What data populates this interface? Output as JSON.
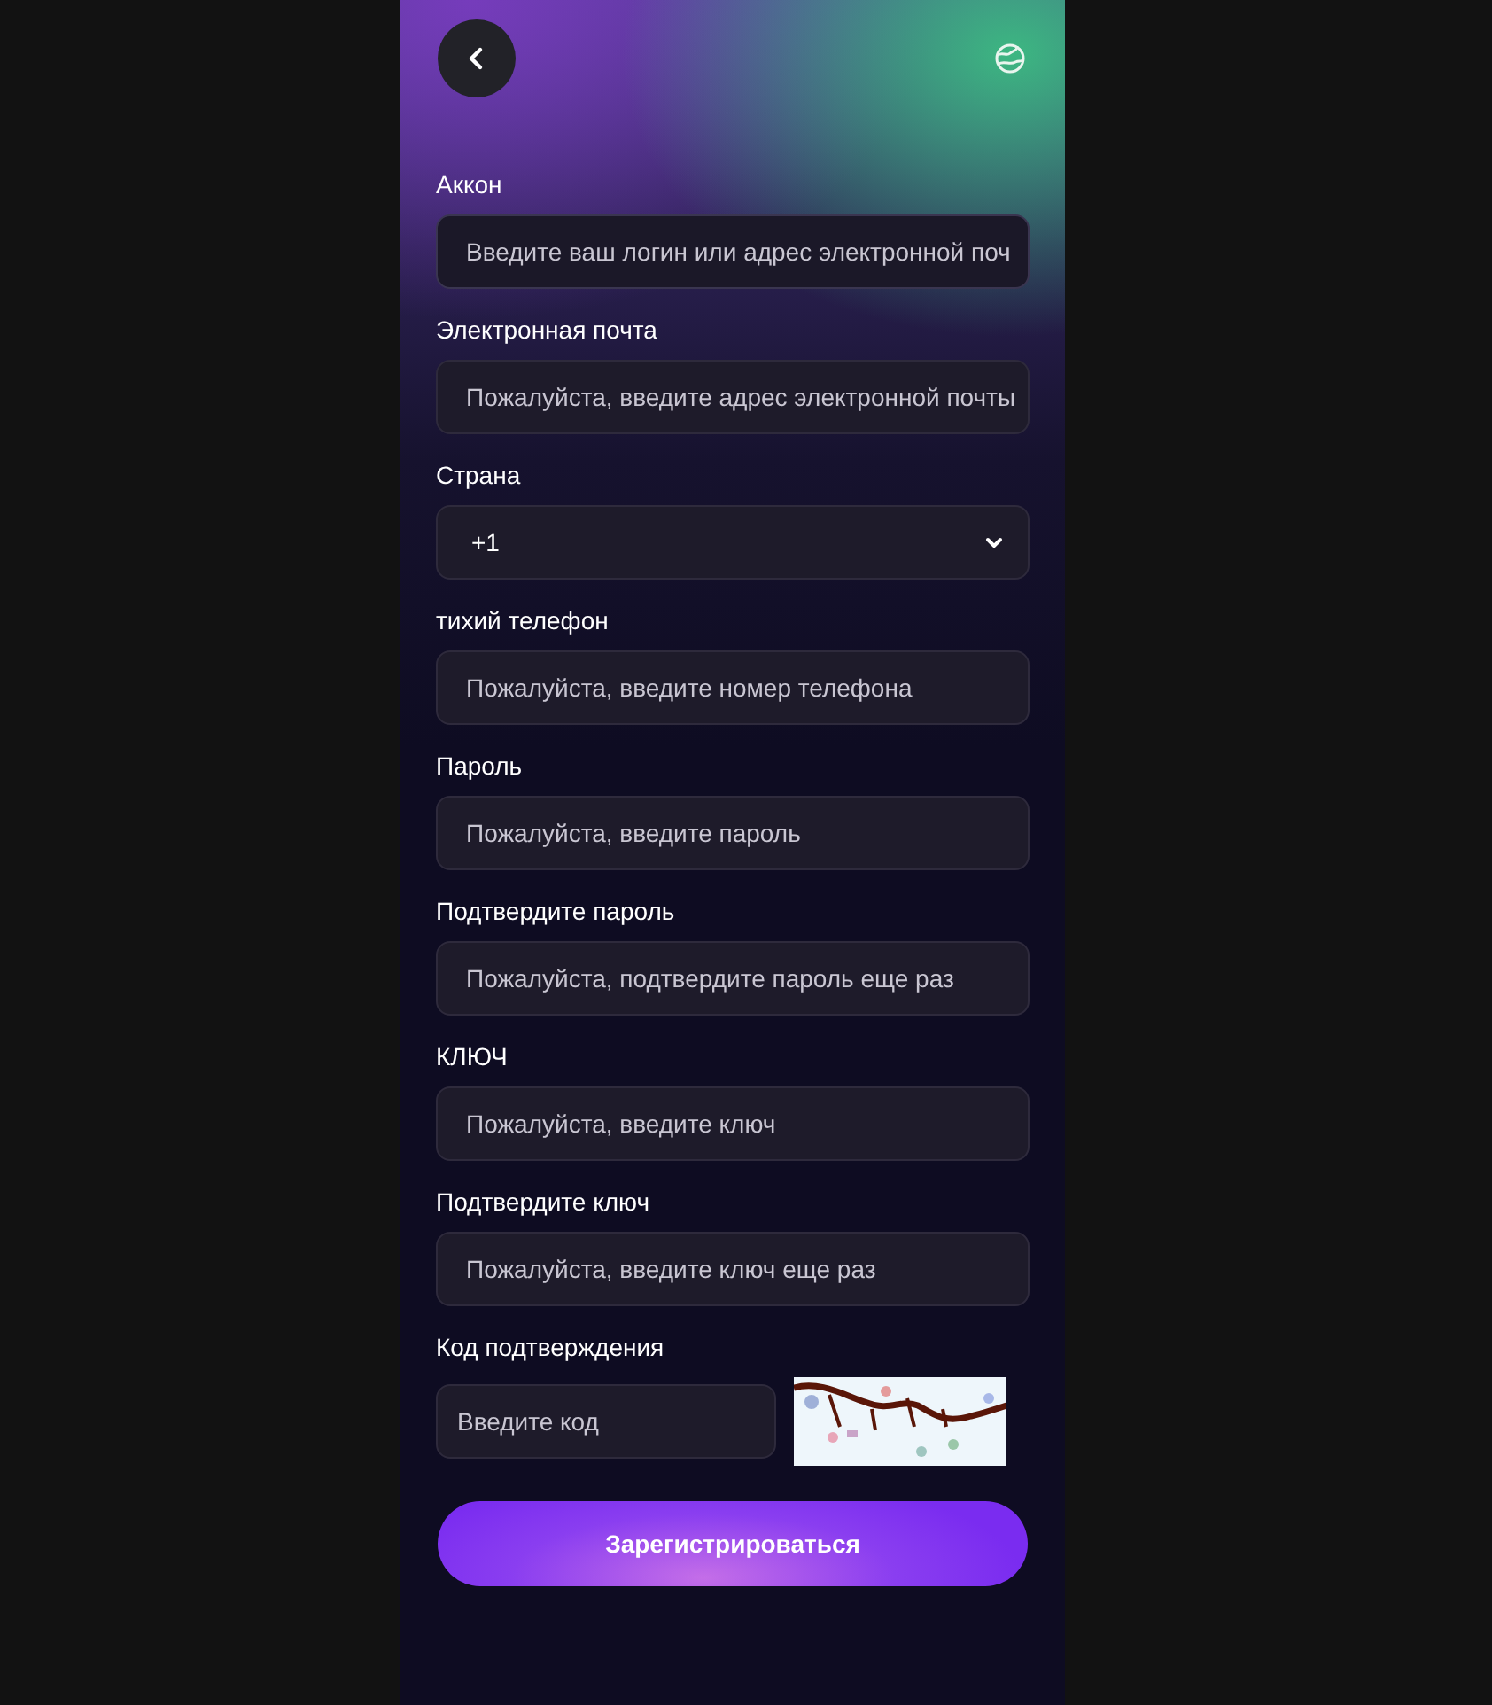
{
  "fields": [
    {
      "kind": "input",
      "label": "Аккон",
      "placeholder": "Введите ваш логин или адрес электронной поч"
    },
    {
      "kind": "input",
      "label": "Электронная почта",
      "placeholder": "Пожалуйста, введите адрес электронной почты"
    },
    {
      "kind": "select",
      "label": "Страна",
      "value": "+1"
    },
    {
      "kind": "input",
      "label": "тихий телефон",
      "placeholder": "Пожалуйста, введите номер телефона"
    },
    {
      "kind": "input",
      "label": "Пароль",
      "placeholder": "Пожалуйста, введите пароль"
    },
    {
      "kind": "input",
      "label": "Подтвердите пароль",
      "placeholder": "Пожалуйста, подтвердите пароль еще раз"
    },
    {
      "kind": "input",
      "label": "КЛЮЧ",
      "placeholder": "Пожалуйста, введите ключ"
    },
    {
      "kind": "input",
      "label": "Подтвердите ключ",
      "placeholder": "Пожалуйста, введите ключ еще раз"
    }
  ],
  "captcha": {
    "label": "Код подтверждения",
    "placeholder": "Введите код",
    "kind": "picture"
  },
  "submit_button": {
    "label": "Зарегистрироваться"
  }
}
